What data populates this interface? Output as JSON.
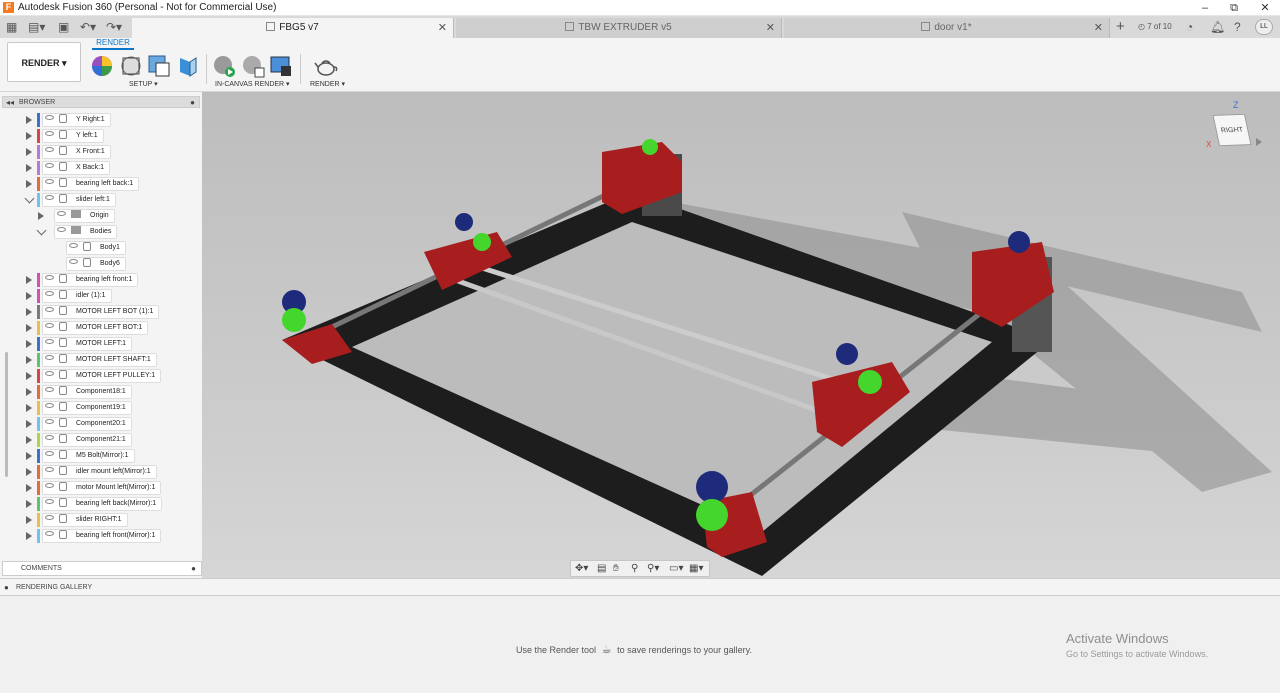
{
  "window": {
    "title": "Autodesk Fusion 360 (Personal - Not for Commercial Use)",
    "logo": "F",
    "min": "–",
    "max": "⧉",
    "close": "✕"
  },
  "tabs": [
    {
      "label": "FBG5 v7",
      "active": true
    },
    {
      "label": "TBW EXTRUDER v5",
      "active": false
    },
    {
      "label": "door v1*",
      "active": false
    }
  ],
  "tabbar": {
    "plus": "+",
    "count": "7 of 10",
    "user": "LL"
  },
  "toolbar": {
    "workspace": "RENDER ▾",
    "active_tab": "RENDER",
    "groups": {
      "setup": "SETUP ▾",
      "incanvas": "IN-CANVAS RENDER ▾",
      "render": "RENDER ▾"
    }
  },
  "browser": {
    "title": "BROWSER",
    "items": [
      {
        "label": "Y Right:1",
        "color": "#3f6fd1",
        "indent": 0,
        "kind": "comp"
      },
      {
        "label": "Y left:1",
        "color": "#e0404a",
        "indent": 0,
        "kind": "comp"
      },
      {
        "label": "X Front:1",
        "color": "#b57ad8",
        "indent": 0,
        "kind": "comp"
      },
      {
        "label": "X Back:1",
        "color": "#b57ad8",
        "indent": 0,
        "kind": "comp"
      },
      {
        "label": "bearing left back:1",
        "color": "#e56b30",
        "indent": 0,
        "kind": "comp"
      },
      {
        "label": "slider left:1",
        "color": "#6cc6e8",
        "indent": 0,
        "kind": "comp",
        "open": true
      },
      {
        "label": "Origin",
        "color": "",
        "indent": 1,
        "kind": "folder"
      },
      {
        "label": "Bodies",
        "color": "",
        "indent": 1,
        "kind": "folder",
        "open": true
      },
      {
        "label": "Body1",
        "color": "",
        "indent": 2,
        "kind": "body"
      },
      {
        "label": "Body6",
        "color": "",
        "indent": 2,
        "kind": "body"
      },
      {
        "label": "bearing left front:1",
        "color": "#d94fae",
        "indent": 0,
        "kind": "comp"
      },
      {
        "label": "idler (1):1",
        "color": "#d94fae",
        "indent": 0,
        "kind": "comp"
      },
      {
        "label": "MOTOR LEFT BOT (1):1",
        "color": "#7a7a7a",
        "indent": 0,
        "kind": "comp"
      },
      {
        "label": "MOTOR LEFT BOT:1",
        "color": "#e6c04a",
        "indent": 0,
        "kind": "comp"
      },
      {
        "label": "MOTOR LEFT:1",
        "color": "#3f6fd1",
        "indent": 0,
        "kind": "comp"
      },
      {
        "label": "MOTOR LEFT SHAFT:1",
        "color": "#5cc66a",
        "indent": 0,
        "kind": "comp"
      },
      {
        "label": "MOTOR LEFT PULLEY:1",
        "color": "#e0404a",
        "indent": 0,
        "kind": "comp"
      },
      {
        "label": "Component18:1",
        "color": "#e56b30",
        "indent": 0,
        "kind": "comp"
      },
      {
        "label": "Component19:1",
        "color": "#e6c04a",
        "indent": 0,
        "kind": "comp"
      },
      {
        "label": "Component20:1",
        "color": "#6cc6e8",
        "indent": 0,
        "kind": "comp"
      },
      {
        "label": "Component21:1",
        "color": "#a8d84a",
        "indent": 0,
        "kind": "comp"
      },
      {
        "label": "M5 Bolt(Mirror):1",
        "color": "#3f6fd1",
        "indent": 0,
        "kind": "comp"
      },
      {
        "label": "idler mount left(Mirror):1",
        "color": "#e56b30",
        "indent": 0,
        "kind": "comp"
      },
      {
        "label": "motor Mount left(Mirror):1",
        "color": "#e56b30",
        "indent": 0,
        "kind": "comp"
      },
      {
        "label": "bearing left back(Mirror):1",
        "color": "#5cc66a",
        "indent": 0,
        "kind": "comp"
      },
      {
        "label": "slider RIGHT:1",
        "color": "#e6c04a",
        "indent": 0,
        "kind": "comp"
      },
      {
        "label": "bearing left front(Mirror):1",
        "color": "#6cc6e8",
        "indent": 0,
        "kind": "comp"
      }
    ]
  },
  "comments": {
    "label": "COMMENTS"
  },
  "viewcube": {
    "face": "RIGHT",
    "z": "Z",
    "x": "X"
  },
  "gallery": {
    "title": "RENDERING GALLERY",
    "hint_before": "Use the Render tool",
    "hint_after": "to save renderings to your gallery."
  },
  "watermark": {
    "line1": "Activate Windows",
    "line2": "Go to Settings to activate Windows."
  }
}
